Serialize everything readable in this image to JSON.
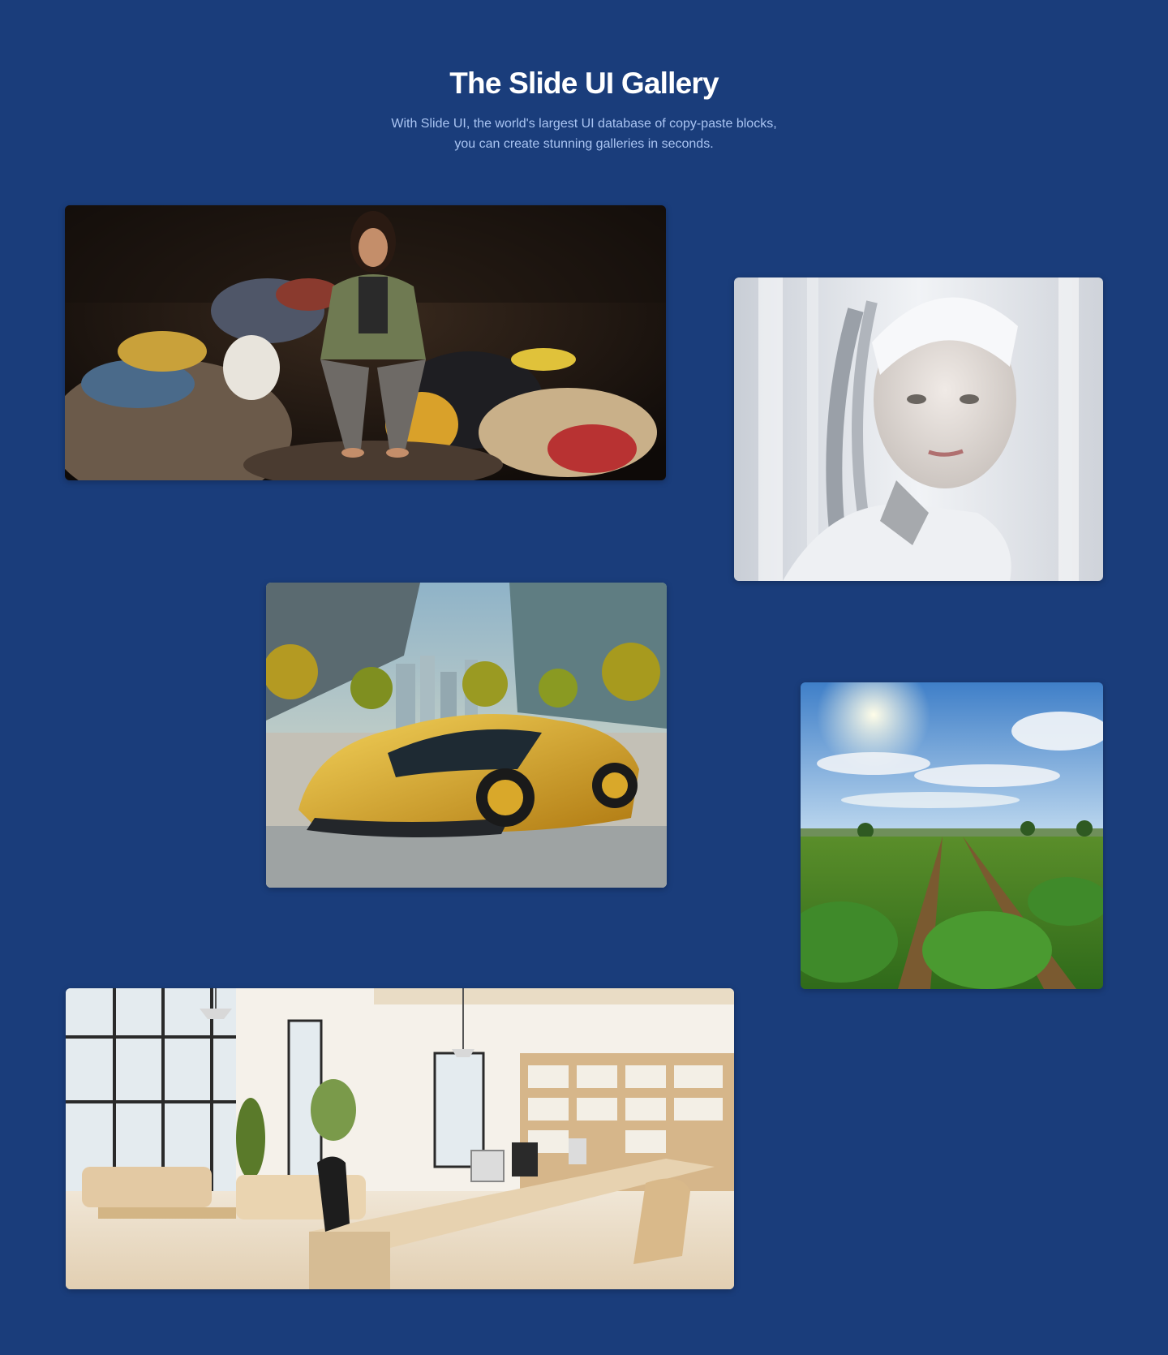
{
  "header": {
    "title": "The Slide UI Gallery",
    "subtitle_line1": "With Slide UI, the world's largest UI database of copy-paste blocks,",
    "subtitle_line2": "you can create stunning galleries in seconds."
  },
  "gallery": {
    "images": [
      {
        "subject": "woman sitting among piles of clothes"
      },
      {
        "subject": "white humanoid robot portrait"
      },
      {
        "subject": "golden futuristic sports car in city"
      },
      {
        "subject": "green crop field under blue sky"
      },
      {
        "subject": "bright modern open-plan office interior"
      }
    ]
  },
  "colors": {
    "background": "#1a3d7b",
    "title": "#ffffff",
    "subtitle": "#a9c4f2"
  }
}
